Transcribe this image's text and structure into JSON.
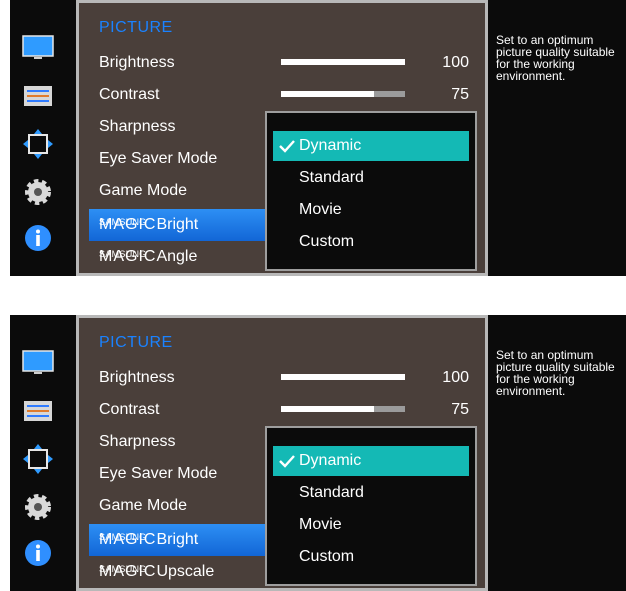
{
  "menu": {
    "title": "PICTURE",
    "items": [
      {
        "label": "Brightness",
        "value": "100",
        "level": 1.0
      },
      {
        "label": "Contrast",
        "value": "75",
        "level": 0.75
      },
      {
        "label": "Sharpness"
      },
      {
        "label": "Eye Saver Mode"
      },
      {
        "label": "Game Mode"
      }
    ],
    "magic_bright": {
      "prefix_small": "SAMSUNG",
      "prefix_big": "MAGIC",
      "label": "Bright"
    },
    "magic_angle": {
      "prefix_small": "SAMSUNG",
      "prefix_big": "MAGIC",
      "label": "Angle"
    },
    "magic_upscale": {
      "prefix_small": "SAMSUNG",
      "prefix_big": "MAGIC",
      "label": "Upscale"
    }
  },
  "dropdown": {
    "options": [
      "Dynamic",
      "Standard",
      "Movie",
      "Custom"
    ],
    "selected": "Dynamic"
  },
  "description": "Set to an optimum picture quality suitable for the working environment.",
  "colors": {
    "title_blue": "#1a82ff",
    "highlight_teal": "#14b9b5",
    "menu_bg": "#4a3f3a",
    "selected_blue": "#1f7ae6"
  },
  "icons": [
    "monitor-icon",
    "settings-panel-icon",
    "move-arrows-icon",
    "gear-icon",
    "info-icon"
  ]
}
